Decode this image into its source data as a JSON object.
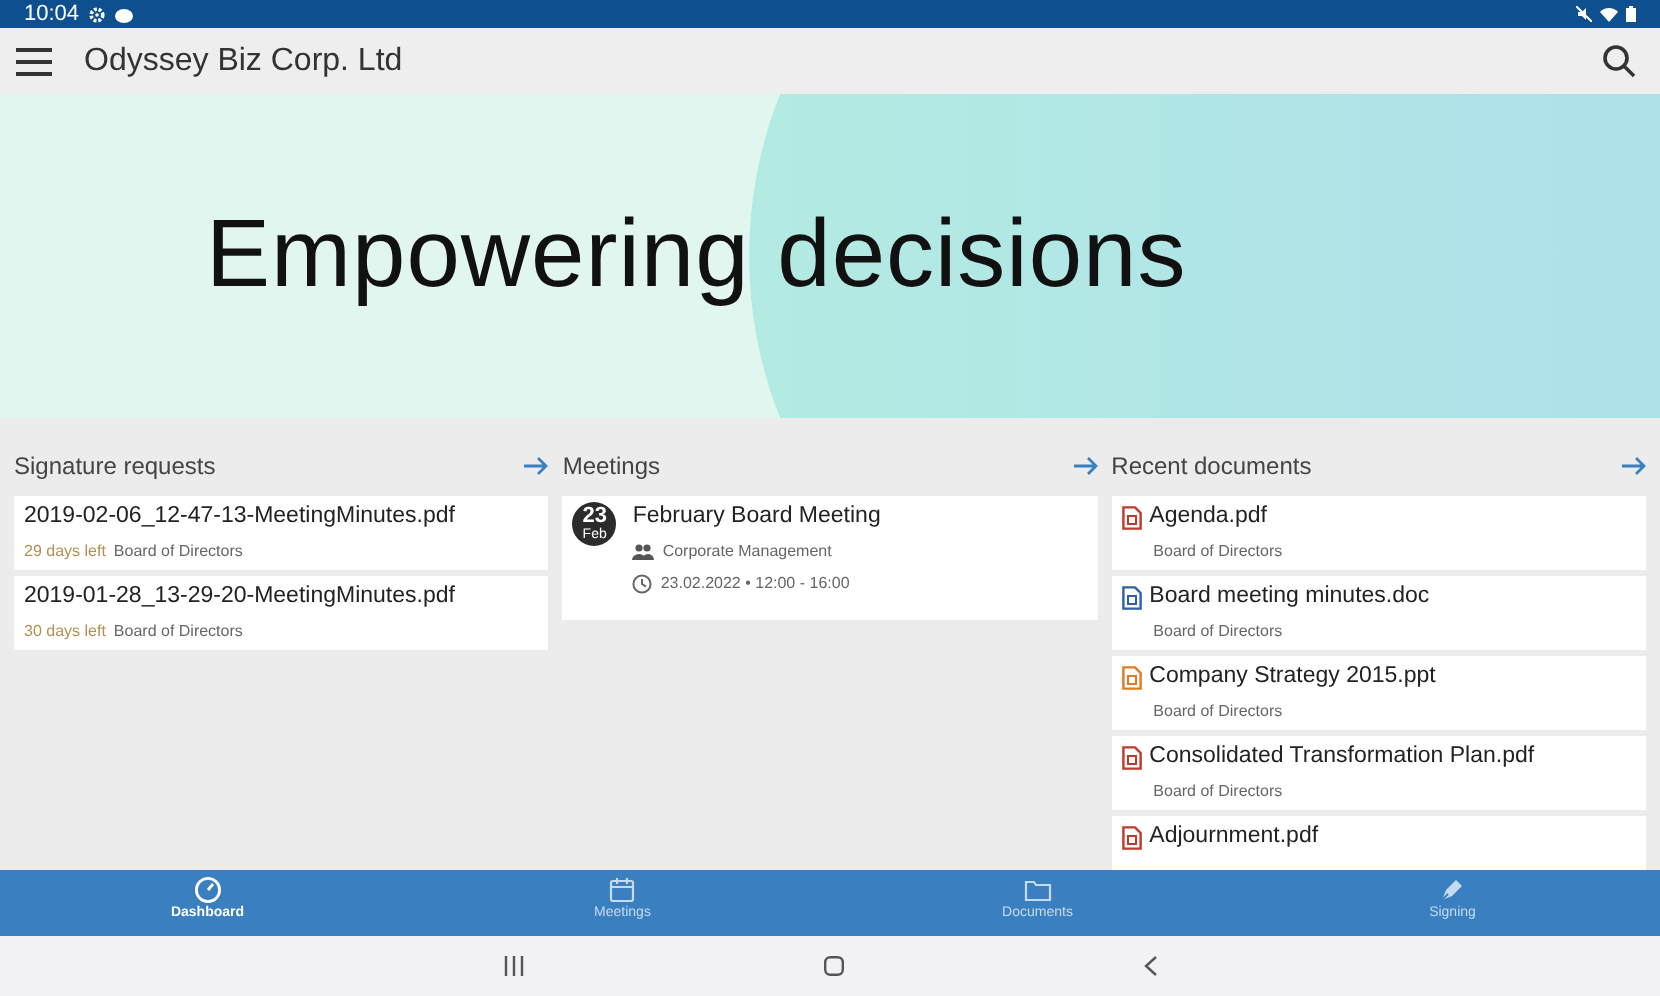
{
  "status_bar": {
    "time": "10:04"
  },
  "app_bar": {
    "title": "Odyssey Biz Corp. Ltd"
  },
  "banner": {
    "headline": "Empowering decisions"
  },
  "sections": [
    {
      "kind": "signatures",
      "title": "Signature requests",
      "items": [
        {
          "name": "2019-02-06_12-47-13-MeetingMinutes.pdf",
          "due": "29 days left",
          "group": "Board of Directors"
        },
        {
          "name": "2019-01-28_13-29-20-MeetingMinutes.pdf",
          "due": "30 days left",
          "group": "Board of Directors"
        }
      ]
    },
    {
      "kind": "meetings",
      "title": "Meetings",
      "items": [
        {
          "day": "23",
          "month": "Feb",
          "name": "February Board Meeting",
          "committee": "Corporate Management",
          "when": "23.02.2022 • 12:00 - 16:00"
        }
      ]
    },
    {
      "kind": "documents",
      "title": "Recent documents",
      "items": [
        {
          "kind": "pdf",
          "name": "Agenda.pdf",
          "group": "Board of Directors"
        },
        {
          "kind": "doc",
          "name": "Board meeting minutes.doc",
          "group": "Board of Directors"
        },
        {
          "kind": "ppt",
          "name": "Company Strategy 2015.ppt",
          "group": "Board of Directors"
        },
        {
          "kind": "pdf",
          "name": "Consolidated Transformation Plan.pdf",
          "group": "Board of Directors"
        },
        {
          "kind": "pdf",
          "name": "Adjournment.pdf"
        }
      ]
    }
  ],
  "bottom_nav": [
    {
      "kind": "dashboard",
      "label": "Dashboard",
      "selected": true
    },
    {
      "kind": "meetings",
      "label": "Meetings",
      "selected": false
    },
    {
      "kind": "documents",
      "label": "Documents",
      "selected": false
    },
    {
      "kind": "signing",
      "label": "Signing",
      "selected": false
    }
  ]
}
